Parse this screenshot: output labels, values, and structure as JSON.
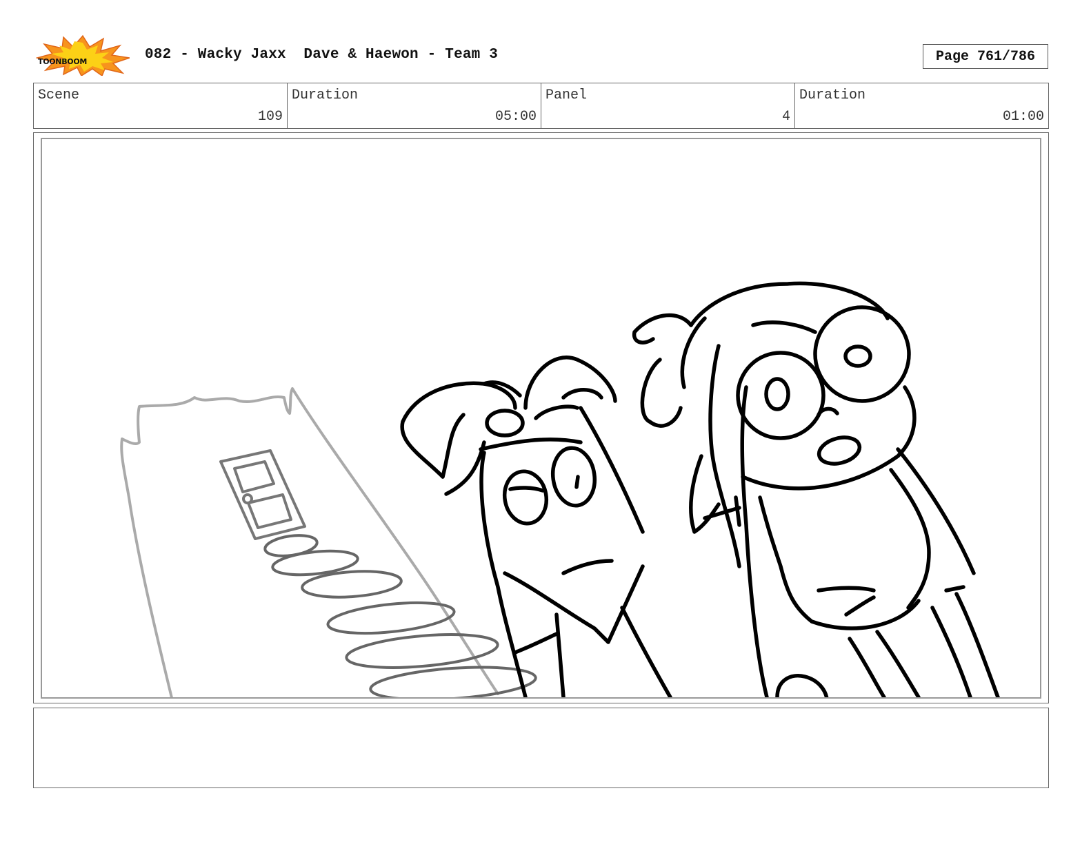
{
  "header": {
    "logo_text": "TOONBOOM",
    "title": "082 - Wacky Jaxx  Dave & Haewon - Team 3",
    "page_label": "Page 761/786"
  },
  "info": {
    "scene_label": "Scene",
    "scene_value": "109",
    "scene_duration_label": "Duration",
    "scene_duration_value": "05:00",
    "panel_label": "Panel",
    "panel_value": "4",
    "panel_duration_label": "Duration",
    "panel_duration_value": "01:00"
  },
  "panel": {
    "drawing": "storyboard-sketch"
  },
  "notes": {
    "text": ""
  }
}
